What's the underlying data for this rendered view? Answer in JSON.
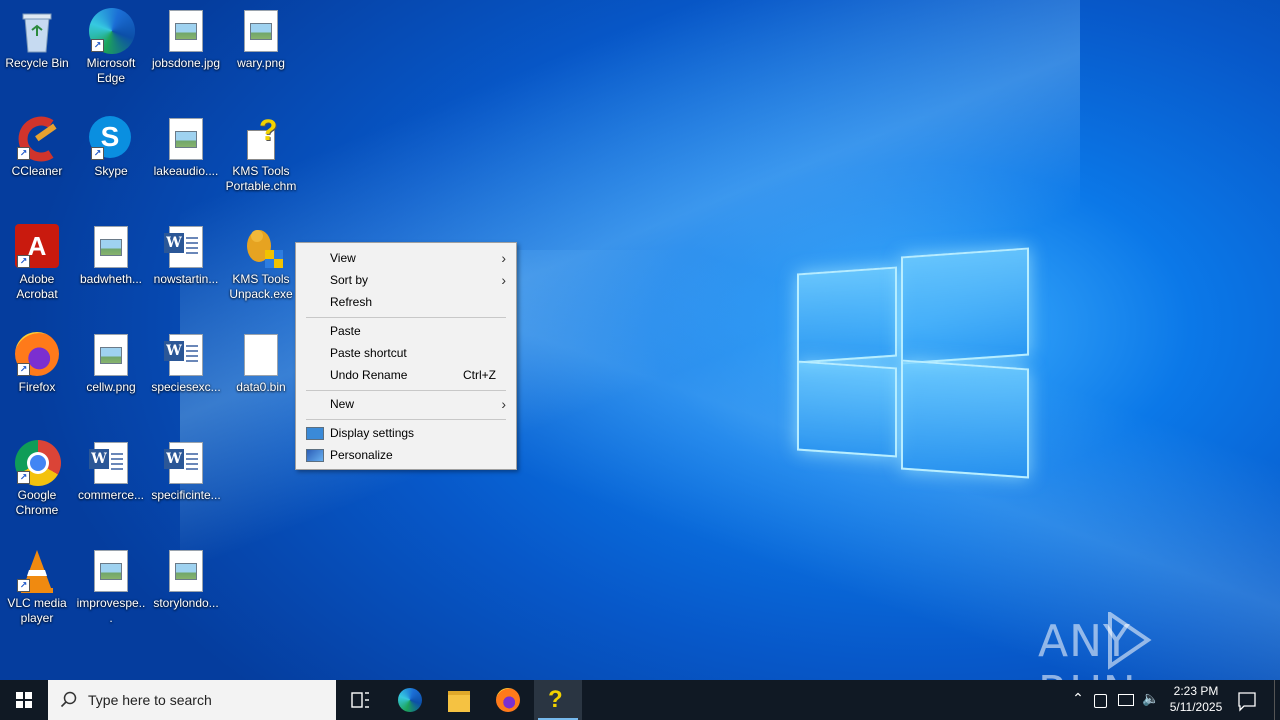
{
  "desktop": {
    "icons": [
      {
        "label": "Recycle Bin",
        "icon": "recycle-bin-icon"
      },
      {
        "label": "Microsoft Edge",
        "icon": "edge-icon"
      },
      {
        "label": "jobsdone.jpg",
        "icon": "image-file-icon"
      },
      {
        "label": "wary.png",
        "icon": "image-file-icon"
      },
      {
        "label": "CCleaner",
        "icon": "ccleaner-icon"
      },
      {
        "label": "Skype",
        "icon": "skype-icon"
      },
      {
        "label": "lakeaudio....",
        "icon": "image-file-icon"
      },
      {
        "label": "KMS Tools Portable.chm",
        "icon": "chm-help-icon"
      },
      {
        "label": "Adobe Acrobat",
        "icon": "acrobat-icon"
      },
      {
        "label": "badwheth...",
        "icon": "image-file-icon"
      },
      {
        "label": "nowstartin...",
        "icon": "word-doc-icon"
      },
      {
        "label": "KMS Tools Unpack.exe",
        "icon": "kms-exe-icon"
      },
      {
        "label": "Firefox",
        "icon": "firefox-icon"
      },
      {
        "label": "cellw.png",
        "icon": "image-file-icon"
      },
      {
        "label": "speciesexc...",
        "icon": "word-doc-icon"
      },
      {
        "label": "data0.bin",
        "icon": "blank-file-icon"
      },
      {
        "label": "Google Chrome",
        "icon": "chrome-icon"
      },
      {
        "label": "commerce...",
        "icon": "word-doc-icon"
      },
      {
        "label": "specificinte...",
        "icon": "word-doc-icon"
      },
      {
        "label": "VLC media player",
        "icon": "vlc-icon"
      },
      {
        "label": "improvespe...",
        "icon": "image-file-icon"
      },
      {
        "label": "storylondo...",
        "icon": "image-file-icon"
      }
    ]
  },
  "context_menu": {
    "view": "View",
    "sort_by": "Sort by",
    "refresh": "Refresh",
    "paste": "Paste",
    "paste_shortcut": "Paste shortcut",
    "undo_rename": "Undo Rename",
    "undo_shortcut": "Ctrl+Z",
    "new": "New",
    "display_settings": "Display settings",
    "personalize": "Personalize"
  },
  "taskbar": {
    "search_placeholder": "Type here to search",
    "time": "2:23 PM",
    "date": "5/11/2025",
    "pinned": [
      "task-view-icon",
      "edge-icon",
      "file-explorer-icon",
      "firefox-icon",
      "kms-chm-icon"
    ]
  },
  "watermark": {
    "text": "ANY RUN"
  },
  "colors": {
    "taskbar": "#101924",
    "desktop_accent": "#0b78e8",
    "menu_bg": "#f2f2f2"
  }
}
